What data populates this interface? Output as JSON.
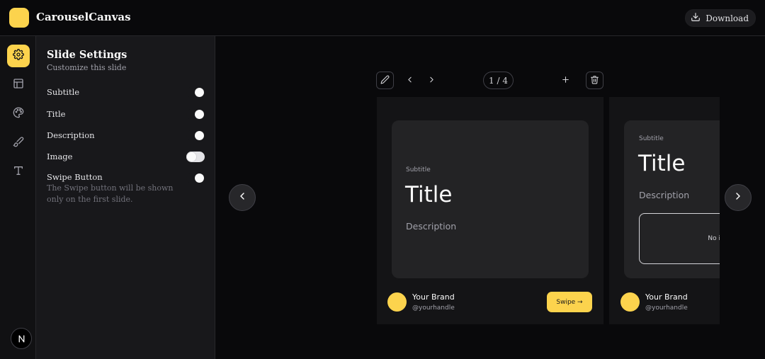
{
  "app": {
    "title": "CarouselCanvas",
    "download_label": "Download",
    "colors": {
      "accent": "#fcd34d",
      "background": "#09090b",
      "panel": "#18181b"
    }
  },
  "rail": {
    "items": [
      {
        "name": "settings",
        "icon": "gear-icon",
        "active": true
      },
      {
        "name": "layout",
        "icon": "layout-icon",
        "active": false
      },
      {
        "name": "theme",
        "icon": "palette-icon",
        "active": false
      },
      {
        "name": "brush",
        "icon": "brush-icon",
        "active": false
      },
      {
        "name": "text",
        "icon": "type-icon",
        "active": false
      }
    ],
    "footer_badge": "N"
  },
  "panel": {
    "title": "Slide Settings",
    "subtitle": "Customize this slide",
    "settings": [
      {
        "label": "Subtitle",
        "enabled": true
      },
      {
        "label": "Title",
        "enabled": true
      },
      {
        "label": "Description",
        "enabled": true
      },
      {
        "label": "Image",
        "enabled": false
      },
      {
        "label": "Swipe Button",
        "enabled": true
      }
    ],
    "swipe_note": "The Swipe button will be shown only on the first slide."
  },
  "canvas": {
    "page_indicator": "1 / 4",
    "slides": [
      {
        "subtitle": "Subtitle",
        "title": "Title",
        "description": "Description",
        "brand_name": "Your Brand",
        "brand_handle": "@yourhandle",
        "swipe_label": "Swipe →"
      },
      {
        "subtitle": "Subtitle",
        "title": "Title",
        "description": "Description",
        "image_placeholder": "No image",
        "brand_name": "Your Brand",
        "brand_handle": "@yourhandle"
      }
    ]
  }
}
